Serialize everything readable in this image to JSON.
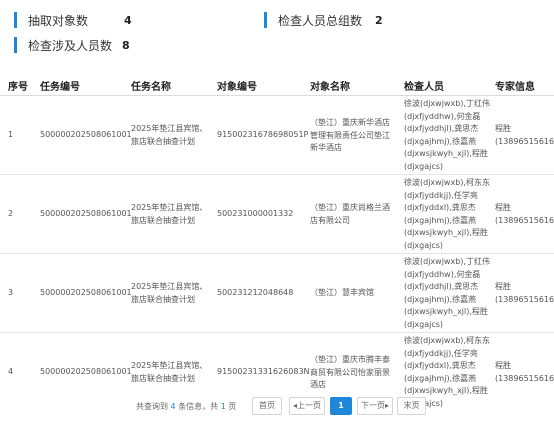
{
  "stats": {
    "extracted_label": "抽取对象数",
    "extracted_value": "4",
    "groups_label": "检查人员总组数",
    "groups_value": "2",
    "persons_label": "检查涉及人员数",
    "persons_value": "8"
  },
  "table": {
    "headers": [
      "序号",
      "任务编号",
      "任务名称",
      "对象编号",
      "对象名称",
      "检查人员",
      "专家信息"
    ],
    "rows": [
      {
        "no": "1",
        "task_no": "500000202508061001",
        "task_name": "2025年垫江县宾馆、旅店联合抽查计划",
        "obj_no": "91500231678698051P",
        "obj_name": "（垫江）重庆新华酒店管理有限责任公司垫江新华酒店",
        "inspectors": "徐波(djxwjwxb),丁红伟(djxfjyddhw),何金磊(djxfjyddhjl),龚思杰(djxgajhmj),徐嘉燕(djxwsjkwyh_xjl),程胜(djxgajcs)",
        "expert": "程胜(13896515616)"
      },
      {
        "no": "2",
        "task_no": "500000202508061001",
        "task_name": "2025年垫江县宾馆、旅店联合抽查计划",
        "obj_no": "500231000001332",
        "obj_name": "（垫江）重庆尚格兰酒店有限公司",
        "inspectors": "徐波(djxwjwxb),柯东东(djxfjyddkjj),任学亮(djxfjyddxl),龚思杰(djxgajhmj),徐嘉燕(djxwsjkwyh_xjl),程胜(djxgajcs)",
        "expert": "程胜(13896515616)"
      },
      {
        "no": "3",
        "task_no": "500000202508061001",
        "task_name": "2025年垫江县宾馆、旅店联合抽查计划",
        "obj_no": "500231212048648",
        "obj_name": "（垫江）慧丰宾馆",
        "inspectors": "徐波(djxwjwxb),丁红伟(djxfjyddhw),何金磊(djxfjyddhjl),龚思杰(djxgajhmj),徐嘉燕(djxwsjkwyh_xjl),程胜(djxgajcs)",
        "expert": "程胜(13896515616)"
      },
      {
        "no": "4",
        "task_no": "500000202508061001",
        "task_name": "2025年垫江县宾馆、旅店联合抽查计划",
        "obj_no": "91500231331626083N",
        "obj_name": "（垫江）重庆市腾丰泰商贸有限公司怡家丽景酒店",
        "inspectors": "徐波(djxwjwxb),柯东东(djxfjyddkjj),任学亮(djxfjyddxl),龚思杰(djxgajhmj),徐嘉燕(djxwsjkwyh_xjl),程胜(djxgajcs)",
        "expert": "程胜(13896515616)"
      }
    ]
  },
  "pager": {
    "prefix": "共查询到",
    "count": "4",
    "mid": "条信息，共",
    "pages": "1",
    "suffix": "页",
    "first": "首页",
    "prev": "◂上一页",
    "current": "1",
    "next": "下一页▸",
    "last": "末页"
  },
  "colors": {
    "accent": "#1e87d8"
  }
}
